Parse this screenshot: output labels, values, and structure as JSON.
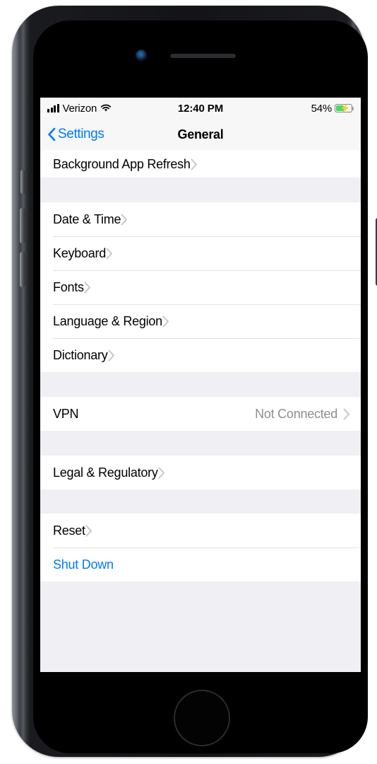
{
  "device": {
    "name": "iphone-8",
    "camera_icon": "front-camera",
    "speaker_icon": "earpiece-speaker",
    "home_button_icon": "home-button"
  },
  "status_bar": {
    "signal_icon": "cellular-signal-icon",
    "signal_bars": 4,
    "carrier": "Verizon",
    "wifi_icon": "wifi-icon",
    "time": "12:40 PM",
    "battery_percent": "54%",
    "battery_level": 54,
    "battery_icon": "battery-charging-icon",
    "charging": true,
    "battery_color": "#4cd763"
  },
  "nav_bar": {
    "back_icon": "chevron-left-icon",
    "back_label": "Settings",
    "title": "General",
    "accent_color": "#007aff"
  },
  "sections": [
    {
      "name": "background-app-refresh",
      "rows": [
        {
          "label": "Background App Refresh",
          "value": "",
          "accessory": "chevron-right-icon",
          "style": "default"
        }
      ]
    },
    {
      "name": "date-keyboard-language",
      "rows": [
        {
          "label": "Date & Time",
          "value": "",
          "accessory": "chevron-right-icon",
          "style": "default"
        },
        {
          "label": "Keyboard",
          "value": "",
          "accessory": "chevron-right-icon",
          "style": "default"
        },
        {
          "label": "Fonts",
          "value": "",
          "accessory": "chevron-right-icon",
          "style": "default"
        },
        {
          "label": "Language & Region",
          "value": "",
          "accessory": "chevron-right-icon",
          "style": "default"
        },
        {
          "label": "Dictionary",
          "value": "",
          "accessory": "chevron-right-icon",
          "style": "default"
        }
      ]
    },
    {
      "name": "vpn",
      "rows": [
        {
          "label": "VPN",
          "value": "Not Connected",
          "accessory": "chevron-right-icon",
          "style": "default"
        }
      ]
    },
    {
      "name": "legal",
      "rows": [
        {
          "label": "Legal & Regulatory",
          "value": "",
          "accessory": "chevron-right-icon",
          "style": "default"
        }
      ]
    },
    {
      "name": "reset-shutdown",
      "rows": [
        {
          "label": "Reset",
          "value": "",
          "accessory": "chevron-right-icon",
          "style": "default"
        },
        {
          "label": "Shut Down",
          "value": "",
          "accessory": "none",
          "style": "blue"
        }
      ]
    }
  ],
  "annotation": {
    "target": "Reset",
    "shape": "rounded-rectangle-outline",
    "color": "#f50000"
  }
}
